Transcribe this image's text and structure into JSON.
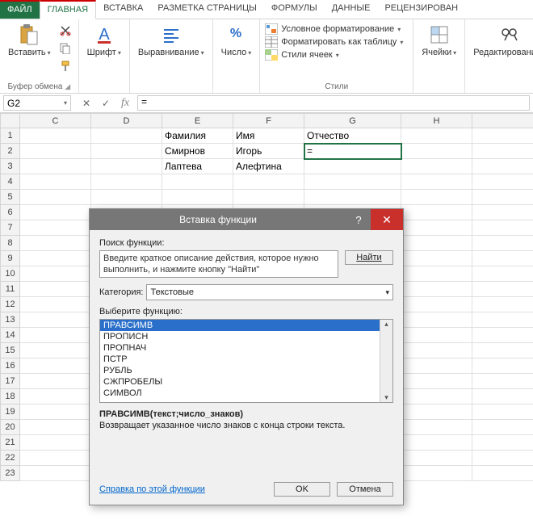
{
  "tabs": {
    "file": "ФАЙЛ",
    "home": "ГЛАВНАЯ",
    "insert": "ВСТАВКА",
    "pagelayout": "РАЗМЕТКА СТРАНИЦЫ",
    "formulas": "ФОРМУЛЫ",
    "data": "ДАННЫЕ",
    "review": "РЕЦЕНЗИРОВАН"
  },
  "ribbon": {
    "clipboard": {
      "paste": "Вставить",
      "label": "Буфер обмена"
    },
    "font": {
      "btn": "Шрифт"
    },
    "alignment": {
      "btn": "Выравнивание"
    },
    "number": {
      "btn": "Число"
    },
    "styles": {
      "cond": "Условное форматирование",
      "table": "Форматировать как таблицу",
      "cell": "Стили ячеек",
      "label": "Стили"
    },
    "cells": {
      "btn": "Ячейки"
    },
    "editing": {
      "btn": "Редактирование"
    }
  },
  "namebox": "G2",
  "formula": "=",
  "columns": [
    "C",
    "D",
    "E",
    "F",
    "G",
    "H"
  ],
  "rows": [
    "1",
    "2",
    "3",
    "4",
    "5",
    "6",
    "7",
    "8",
    "9",
    "10",
    "11",
    "12",
    "13",
    "14",
    "15",
    "16",
    "17",
    "18",
    "19",
    "20",
    "21",
    "22",
    "23"
  ],
  "cells": {
    "E1": "Фамилия",
    "F1": "Имя",
    "G1": "Отчество",
    "E2": "Смирнов",
    "F2": "Игорь",
    "G2": "=",
    "E3": "Лаптева",
    "F3": "Алефтина"
  },
  "dialog": {
    "title": "Вставка функции",
    "search_label": "Поиск функции:",
    "search_text": "Введите краткое описание действия, которое нужно выполнить, и нажмите кнопку \"Найти\"",
    "find_btn": "Найти",
    "category_label": "Категория:",
    "category_value": "Текстовые",
    "select_label": "Выберите функцию:",
    "functions": [
      "ПРАВСИМВ",
      "ПРОПИСН",
      "ПРОПНАЧ",
      "ПСТР",
      "РУБЛЬ",
      "СЖПРОБЕЛЫ",
      "СИМВОЛ"
    ],
    "signature": "ПРАВСИМВ(текст;число_знаков)",
    "description": "Возвращает указанное число знаков с конца строки текста.",
    "help_link": "Справка по этой функции",
    "ok": "OK",
    "cancel": "Отмена"
  }
}
